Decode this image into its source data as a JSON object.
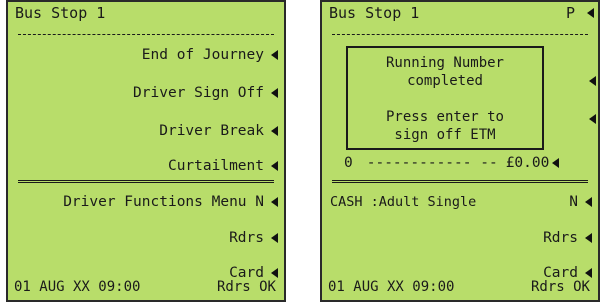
{
  "left": {
    "title": "Bus Stop 1",
    "menu": [
      {
        "label": "End of Journey"
      },
      {
        "label": "Driver Sign Off"
      },
      {
        "label": "Driver Break"
      },
      {
        "label": "Curtailment"
      }
    ],
    "functions_label": "Driver Functions Menu N",
    "rdrs_label": "Rdrs",
    "card_label": "Card",
    "footer_date": "01 AUG XX  09:00",
    "footer_status": "Rdrs OK"
  },
  "right": {
    "title": "Bus Stop 1",
    "flag": "P",
    "dialog": {
      "line1": "Running Number",
      "line2": "completed",
      "line3": "Press enter to",
      "line4": "sign off ETM"
    },
    "fare_zero": "0",
    "fare_dashes": "------------ --",
    "fare_amount": "£0.00",
    "fare_type": "CASH :Adult Single",
    "fare_flag": "N",
    "rdrs_label": "Rdrs",
    "card_label": "Card",
    "footer_date": "01 AUG XX  09:00",
    "footer_status": "Rdrs OK"
  },
  "colors": {
    "screen_bg": "#b8dd6a",
    "text": "#1a1a1a"
  },
  "icons": [
    "select-arrow-icon"
  ]
}
